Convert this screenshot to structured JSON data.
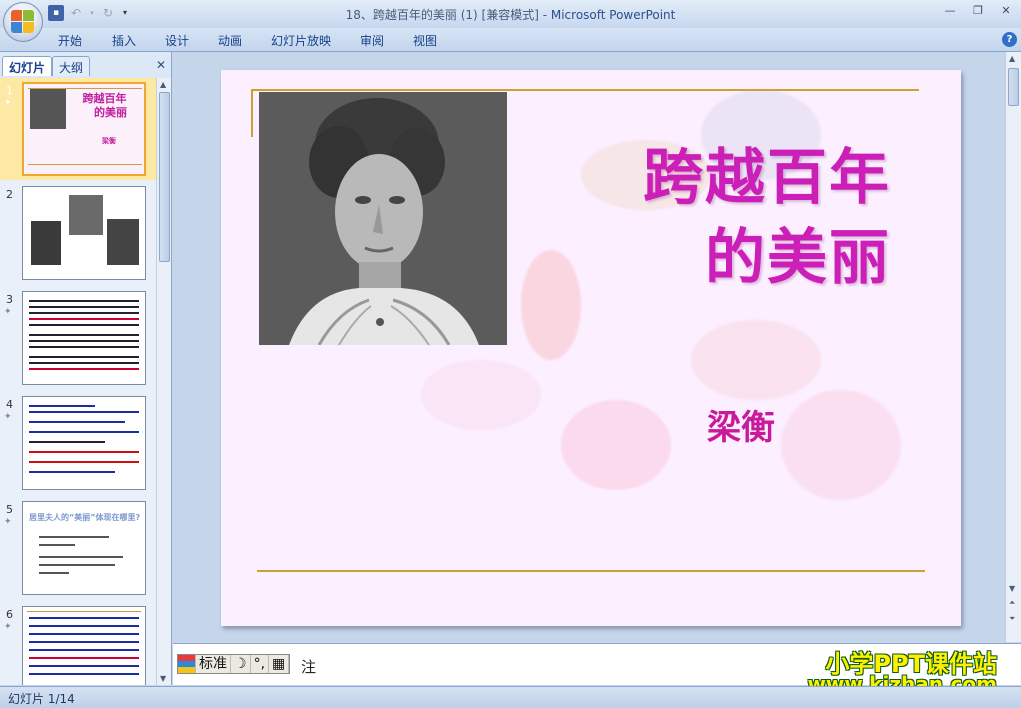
{
  "window": {
    "title_doc": "18、跨越百年的美丽 (1) [兼容模式]",
    "title_sep": " - ",
    "title_app": "Microsoft PowerPoint",
    "minimize": "—",
    "restore": "❐",
    "close": "✕"
  },
  "ribbon": {
    "tabs": [
      "开始",
      "插入",
      "设计",
      "动画",
      "幻灯片放映",
      "审阅",
      "视图"
    ],
    "help": "?"
  },
  "panel": {
    "tab_slides": "幻灯片",
    "tab_outline": "大纲",
    "close": "✕"
  },
  "thumbnails": [
    {
      "number": "1",
      "title_lines": [
        "跨越百年",
        "的美丽"
      ],
      "author": "梁衡"
    },
    {
      "number": "2"
    },
    {
      "number": "3"
    },
    {
      "number": "4"
    },
    {
      "number": "5",
      "title": "居里夫人的“美丽”体现在哪里?"
    },
    {
      "number": "6"
    }
  ],
  "slide": {
    "title_line1": "跨越百年",
    "title_line2": "的美丽",
    "author": "梁衡"
  },
  "notes": {
    "label": "注",
    "ime_mode": "标准"
  },
  "watermark": {
    "line1": "小学PPT课件站",
    "line2": "www.kjzhan.com"
  },
  "status": {
    "slide_counter": "幻灯片 1/14"
  },
  "colors": {
    "title_magenta": "#cc1fb8",
    "gold_line": "#c9a232",
    "slide_bg": "#fcefff"
  }
}
